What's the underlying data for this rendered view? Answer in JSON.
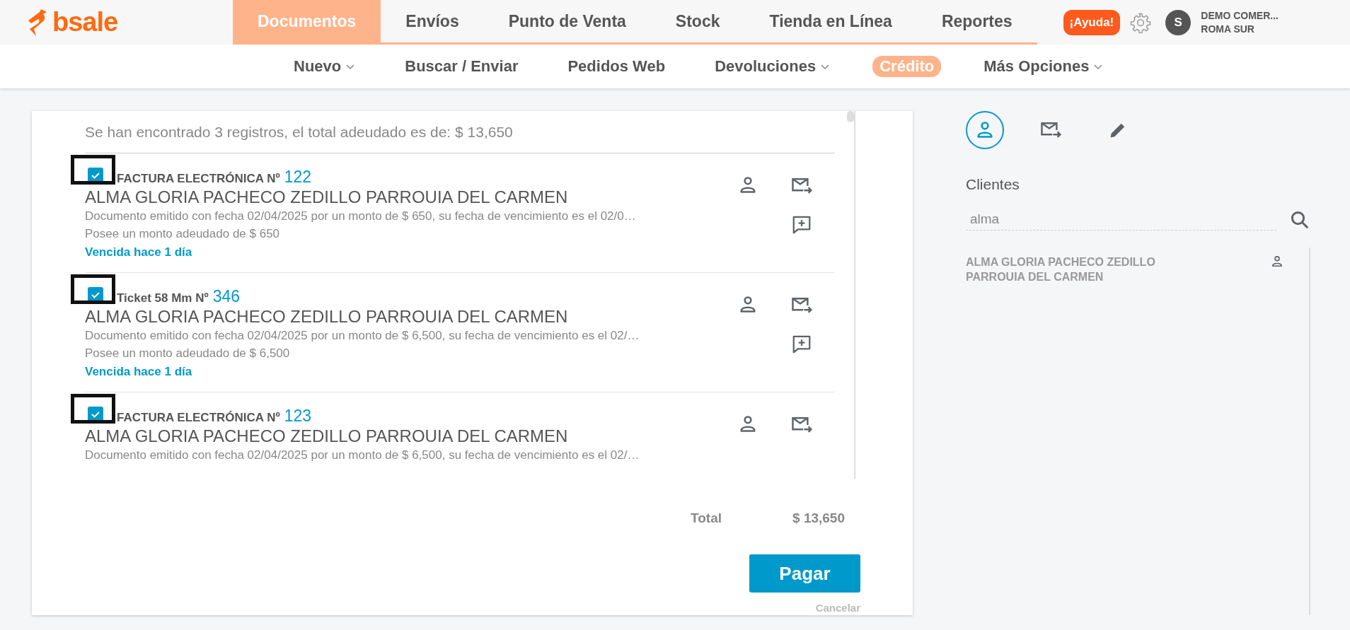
{
  "brand": {
    "name": "bsale"
  },
  "main_nav": [
    {
      "label": "Documentos",
      "selected": true
    },
    {
      "label": "Envíos",
      "selected": false
    },
    {
      "label": "Punto de Venta",
      "selected": false
    },
    {
      "label": "Stock",
      "selected": false
    },
    {
      "label": "Tienda en Línea",
      "selected": false
    },
    {
      "label": "Reportes",
      "selected": false
    }
  ],
  "help_button": "¡Ayuda!",
  "account": {
    "initial": "S",
    "line1": "DEMO COMER...",
    "line2": "ROMA SUR"
  },
  "sub_nav": [
    {
      "label": "Nuevo",
      "dropdown": true,
      "selected": false
    },
    {
      "label": "Buscar / Enviar",
      "dropdown": false,
      "selected": false
    },
    {
      "label": "Pedidos Web",
      "dropdown": false,
      "selected": false
    },
    {
      "label": "Devoluciones",
      "dropdown": true,
      "selected": false
    },
    {
      "label": "Crédito",
      "dropdown": false,
      "selected": true
    },
    {
      "label": "Más Opciones",
      "dropdown": true,
      "selected": false
    }
  ],
  "summary": "Se han encontrado 3 registros, el total adeudado es de: $ 13,650",
  "documents": [
    {
      "checked": true,
      "highlighted": true,
      "doc_type": "FACTURA ELECTRÓNICA Nº",
      "number": "122",
      "client": "ALMA GLORIA PACHECO ZEDILLO PARROUIA DEL CARMEN",
      "description": "Documento emitido con fecha 02/04/2025 por un monto de $ 650, su fecha de vencimiento es el 02/0…",
      "debt": "Posee un monto adeudado de $ 650",
      "status": "Vencida hace 1 día",
      "comment_action": true
    },
    {
      "checked": true,
      "highlighted": true,
      "doc_type": "Ticket 58 Mm Nº",
      "number": "346",
      "client": "ALMA GLORIA PACHECO ZEDILLO PARROUIA DEL CARMEN",
      "description": "Documento emitido con fecha 02/04/2025 por un monto de $ 6,500, su fecha de vencimiento es el 02/…",
      "debt": "Posee un monto adeudado de $ 6,500",
      "status": "Vencida hace 1 día",
      "comment_action": true
    },
    {
      "checked": true,
      "highlighted": true,
      "doc_type": "FACTURA ELECTRÓNICA Nº",
      "number": "123",
      "client": "ALMA GLORIA PACHECO ZEDILLO PARROUIA DEL CARMEN",
      "description": "Documento emitido con fecha 02/04/2025 por un monto de $ 6,500, su fecha de vencimiento es el 02/…",
      "comment_action": false
    }
  ],
  "total": {
    "label": "Total",
    "value": "$ 13,650"
  },
  "pay_button": "Pagar",
  "cancel_link": "Cancelar",
  "side_panel": {
    "tabs": [
      {
        "kind": "person",
        "selected": true
      },
      {
        "kind": "mail",
        "selected": false
      },
      {
        "kind": "edit",
        "selected": false
      }
    ],
    "title": "Clientes",
    "search": {
      "value": "alma"
    },
    "results": [
      {
        "name": "ALMA GLORIA PACHECO ZEDILLO PARROUIA DEL CARMEN"
      }
    ]
  }
}
